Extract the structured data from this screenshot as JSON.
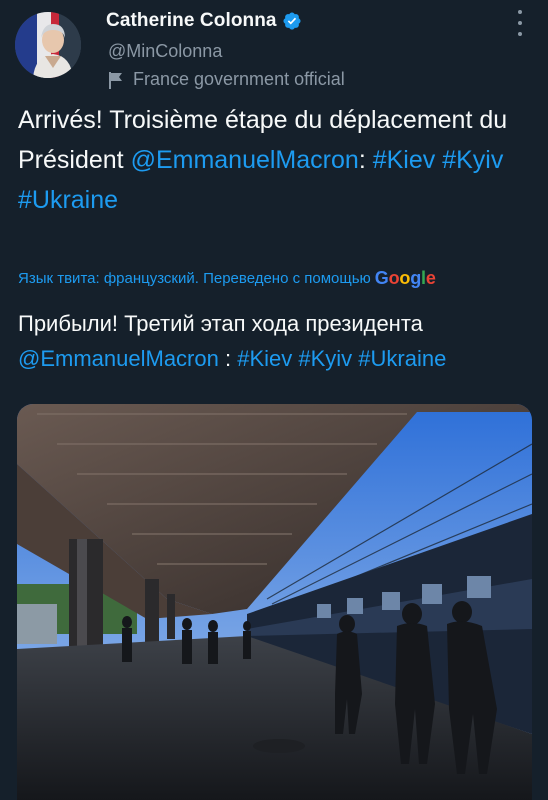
{
  "author": {
    "name": "Catherine Colonna",
    "handle": "@MinColonna",
    "label": "France government official"
  },
  "icons": {
    "verified": "verified-badge-icon",
    "label": "flag-icon",
    "more": "more-options-icon"
  },
  "tweet": {
    "text_1": "Arrivés! Troisième étape du déplacement du Président ",
    "mention": "@EmmanuelMacron",
    "separator": ": ",
    "tag_1": "#Kiev",
    "tag_2": "#Kyiv",
    "tag_3": "#Ukraine"
  },
  "translation_bar": {
    "text": "Язык твита: французский. Переведено с помощью",
    "provider": "Google"
  },
  "translation": {
    "text_1": "Прибыли! Третий этап хода президента ",
    "mention": "@EmmanuelMacron",
    "separator": " : ",
    "tag_1": "#Kiev",
    "tag_2": "#Kyiv",
    "tag_3": "#Ukraine"
  },
  "colors": {
    "background": "#15202b",
    "link": "#1d9bf0",
    "secondary_text": "#8b98a5",
    "verified": "#1d9bf0"
  }
}
